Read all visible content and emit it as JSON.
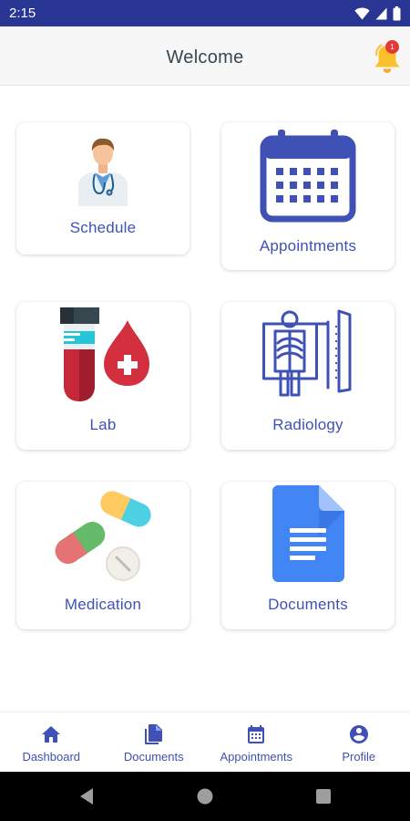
{
  "status_bar": {
    "time": "2:15",
    "icons": [
      "wifi-icon",
      "signal-icon",
      "battery-icon"
    ]
  },
  "app_bar": {
    "title": "Welcome",
    "notification_count": "1",
    "icon": "bell-icon"
  },
  "tiles": [
    {
      "label": "Schedule",
      "icon": "doctor-icon"
    },
    {
      "label": "Appointments",
      "icon": "calendar-icon"
    },
    {
      "label": "Lab",
      "icon": "test-tube-blood-icon"
    },
    {
      "label": "Radiology",
      "icon": "xray-icon"
    },
    {
      "label": "Medication",
      "icon": "pills-icon"
    },
    {
      "label": "Documents",
      "icon": "document-icon"
    }
  ],
  "bottom_nav": [
    {
      "label": "Dashboard",
      "icon": "home-icon"
    },
    {
      "label": "Documents",
      "icon": "documents-icon"
    },
    {
      "label": "Appointments",
      "icon": "calendar-icon"
    },
    {
      "label": "Profile",
      "icon": "profile-icon"
    }
  ],
  "colors": {
    "primary": "#3f51b5",
    "status_bar": "#283593",
    "bell": "#fbc02d",
    "badge": "#e53935"
  }
}
